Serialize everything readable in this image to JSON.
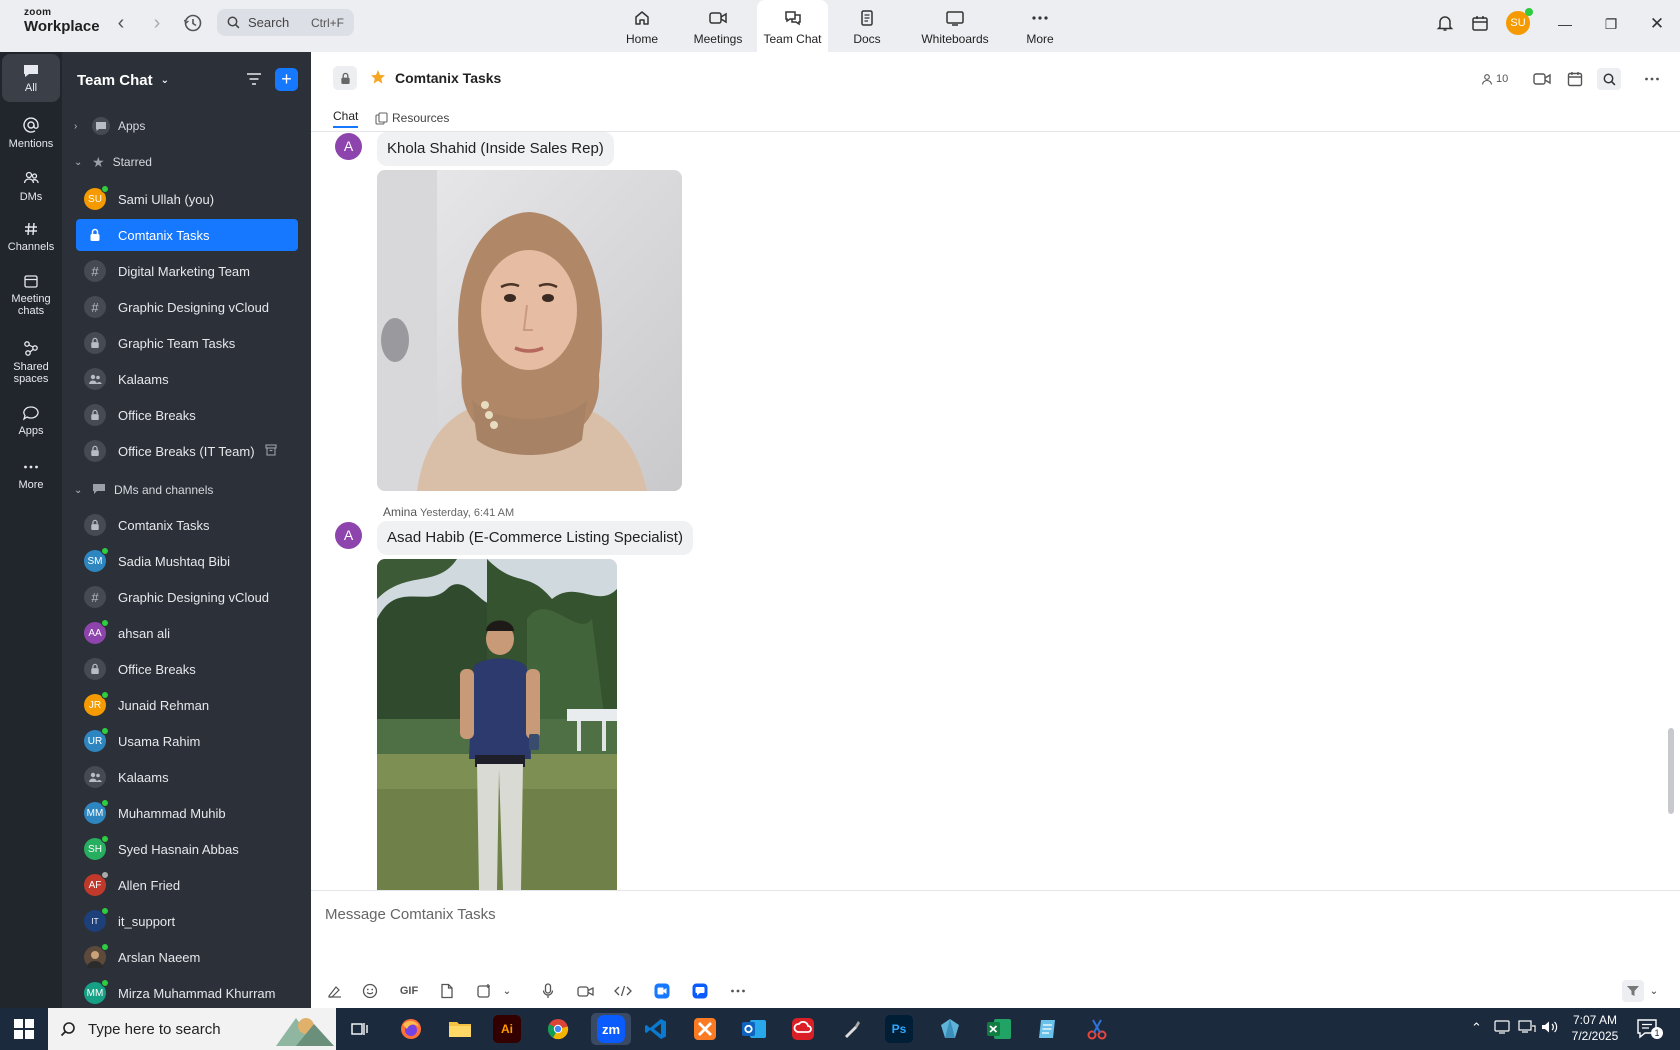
{
  "topbar": {
    "logo_line1": "zoom",
    "logo_line2": "Workplace",
    "search_label": "Search",
    "search_shortcut": "Ctrl+F",
    "tabs": [
      {
        "label": "Home"
      },
      {
        "label": "Meetings"
      },
      {
        "label": "Team Chat"
      },
      {
        "label": "Docs"
      },
      {
        "label": "Whiteboards"
      },
      {
        "label": "More"
      }
    ],
    "user_initials": "SU"
  },
  "rail": {
    "items": [
      {
        "label": "All"
      },
      {
        "label": "Mentions"
      },
      {
        "label": "DMs"
      },
      {
        "label": "Channels"
      },
      {
        "label": "Meeting chats"
      },
      {
        "label": "Shared spaces"
      },
      {
        "label": "Apps"
      },
      {
        "label": "More"
      }
    ]
  },
  "sidebar": {
    "title": "Team Chat",
    "sections": {
      "apps": "Apps",
      "starred": "Starred",
      "dms": "DMs and channels"
    },
    "starred": [
      {
        "label": "Sami Ullah (you)",
        "initials": "SU"
      },
      {
        "label": "Comtanix Tasks"
      },
      {
        "label": "Digital Marketing Team"
      },
      {
        "label": "Graphic Designing vCloud"
      },
      {
        "label": "Graphic Team Tasks"
      },
      {
        "label": "Kalaams"
      },
      {
        "label": "Office Breaks"
      },
      {
        "label": "Office Breaks (IT Team)"
      }
    ],
    "dms": [
      {
        "label": "Comtanix Tasks"
      },
      {
        "label": "Sadia Mushtaq Bibi",
        "initials": "SM"
      },
      {
        "label": "Graphic Designing vCloud"
      },
      {
        "label": "ahsan ali",
        "initials": "AA"
      },
      {
        "label": "Office Breaks"
      },
      {
        "label": "Junaid Rehman",
        "initials": "JR"
      },
      {
        "label": "Usama Rahim",
        "initials": "UR"
      },
      {
        "label": "Kalaams"
      },
      {
        "label": "Muhammad Muhib",
        "initials": "MM"
      },
      {
        "label": "Syed Hasnain Abbas",
        "initials": "SH"
      },
      {
        "label": "Allen Fried",
        "initials": "AF"
      },
      {
        "label": "it_support",
        "initials": "IT"
      },
      {
        "label": "Arslan Naeem"
      },
      {
        "label": "Mirza Muhammad Khurram",
        "initials": "MM"
      }
    ]
  },
  "chat": {
    "title": "Comtanix Tasks",
    "tabs": [
      {
        "label": "Chat"
      },
      {
        "label": "Resources"
      }
    ],
    "member_count": "10",
    "messages": [
      {
        "avatar": "A",
        "text": "Khola Shahid (Inside Sales Rep)"
      },
      {
        "avatar": "A",
        "sender": "Amina",
        "time": "Yesterday, 6:41 AM",
        "text": "Asad Habib (E-Commerce Listing Specialist)"
      }
    ],
    "composer_placeholder": "Message Comtanix Tasks",
    "composer_gif": "GIF"
  },
  "taskbar": {
    "search_placeholder": "Type here to search",
    "time": "7:07 AM",
    "date": "7/2/2025",
    "notification_count": "1",
    "apps": [
      {
        "label": "Ai"
      },
      {
        "label": "zm"
      },
      {
        "label": "Ps"
      }
    ]
  },
  "colors": {
    "accent": "#1677ff",
    "sidebar_bg": "#2c3038",
    "rail_bg": "#21252c",
    "online": "#2ecc40"
  }
}
